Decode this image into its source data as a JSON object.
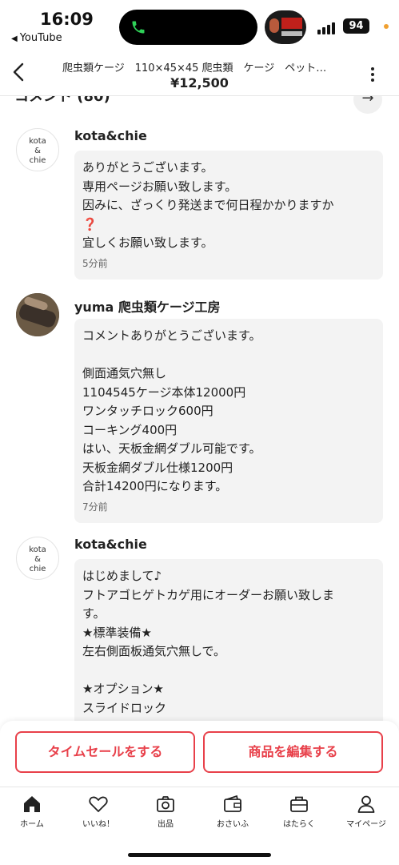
{
  "status_bar": {
    "time": "16:09",
    "back_app": "YouTube",
    "battery": "94"
  },
  "header": {
    "title": "爬虫類ケージ　110×45×45 爬虫類　ケージ　ペット…",
    "price": "¥12,500"
  },
  "comments_section": {
    "title": "コメント (80)"
  },
  "comments": [
    {
      "author": "kota&chie",
      "avatar_text": [
        "kota",
        "&",
        "chie"
      ],
      "lines": [
        "ありがとうございます。",
        "専用ページお願い致します。",
        "因みに、ざっくり発送まで何日程かかりますか",
        "❓",
        "宜しくお願い致します。"
      ],
      "time_ago": "5分前"
    },
    {
      "author": "yuma 爬虫類ケージ工房",
      "lines": [
        "コメントありがとうございます。",
        "",
        "側面通気穴無し",
        "1104545ケージ本体12000円",
        "ワンタッチロック600円",
        "コーキング400円",
        "はい、天板金網ダブル可能です。",
        "天板金網ダブル仕様1200円",
        "合計14200円になります。"
      ],
      "time_ago": "7分前"
    },
    {
      "author": "kota&chie",
      "avatar_text": [
        "kota",
        "&",
        "chie"
      ],
      "lines": [
        "はじめまして♪",
        "フトアゴヒゲトカゲ用にオーダーお願い致しま",
        "す。",
        "★標準装備★",
        "左右側面板通気穴無しで。",
        "",
        "★オプション★",
        "スライドロック"
      ]
    }
  ],
  "actions": {
    "timesale": "タイムセールをする",
    "edit": "商品を編集する"
  },
  "tabs": [
    {
      "label": "ホーム",
      "icon": "home-icon"
    },
    {
      "label": "いいね！",
      "icon": "heart-icon"
    },
    {
      "label": "出品",
      "icon": "camera-icon"
    },
    {
      "label": "おさいふ",
      "icon": "wallet-icon"
    },
    {
      "label": "はたらく",
      "icon": "briefcase-icon"
    },
    {
      "label": "マイページ",
      "icon": "person-icon"
    }
  ],
  "colors": {
    "accent": "#e8404a",
    "bubble": "#f3f3f3"
  }
}
